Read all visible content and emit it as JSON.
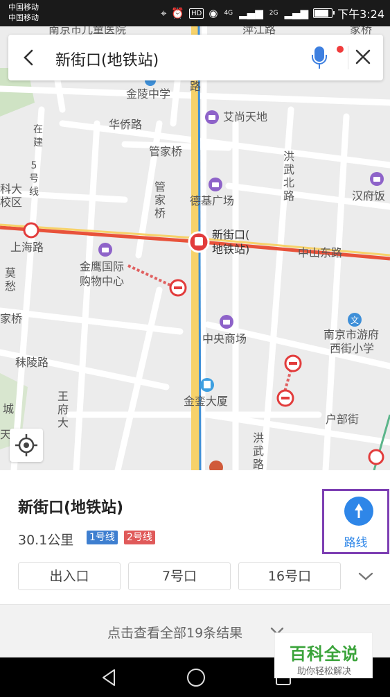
{
  "status_bar": {
    "carrier_1": "中国移动",
    "carrier_2": "中国移动",
    "hd_badge": "HD",
    "net_4g": "4G",
    "net_2g": "2G",
    "time": "下午3:24",
    "battery_level": 0.85,
    "icons": [
      "location-icon",
      "alarm-icon",
      "eye-icon",
      "signal-icon",
      "battery-icon"
    ]
  },
  "search": {
    "query": "新街口(地铁站)",
    "back_icon": "chevron-left-icon",
    "mic_icon": "microphone-icon",
    "close_icon": "close-icon",
    "mic_color": "#3d7fe0",
    "notify_color": "#f03c3c"
  },
  "map": {
    "labels": {
      "children_hospital": "南京市儿童医院",
      "top_mid": "萍江路",
      "top_right": "家桥",
      "jinling_school": "金陵中学",
      "road_fragment": "路",
      "aishang": "艾尚天地",
      "huaqiao_road": "华侨路",
      "guanjiaqiao": "管家桥",
      "zaijian": "在建",
      "line5": "5号线",
      "hongwu_north": "洪武北路",
      "hotel": "汉府饭",
      "left_school_1": "科大",
      "left_school_2": "校区",
      "guanjia_v": "管家桥",
      "deji": "德基广场",
      "xinjiekou_1": "新街口(",
      "xinjiekou_2": "地铁站)",
      "shanghai_road": "上海路",
      "zhongshan_east": "中山东路",
      "jinying_1": "金鹰国际",
      "jinying_2": "购物中心",
      "mochou_v": "莫愁",
      "left_jiaqiao": "家桥",
      "zhongyang": "中央商场",
      "youyou_1": "南京市游府",
      "youyou_2": "西街小学",
      "moling_road": "秣陵路",
      "jinling_building": "金銮大厦",
      "wangfu_v": "王府大",
      "cheng": "城",
      "tian": "天",
      "hubu_street": "户部街",
      "hongwu_road": "洪武路"
    },
    "colors": {
      "background": "#ececec",
      "road": "#ffffff",
      "main_road": "#f7d26a",
      "metro_line_2": "#e8523a",
      "metro_line_1": "#3e8fd8",
      "park": "#cfe3c4",
      "shop_poi": "#8e63c9"
    }
  },
  "locate_icon": "crosshair-icon",
  "panel": {
    "title": "新街口(地铁站)",
    "distance": "30.1公里",
    "lines": [
      {
        "label": "1号线",
        "color": "#3e7fd0"
      },
      {
        "label": "2号线",
        "color": "#e05a5a"
      }
    ],
    "route_label": "路线",
    "route_icon": "route-arrow-icon",
    "exits": [
      "出入口",
      "7号口",
      "16号口"
    ],
    "expand_icon": "chevron-down-icon",
    "results_text": "点击查看全部19条结果",
    "results_icon": "chevron-down-icon"
  },
  "nav_bar": {
    "icons": [
      "back-triangle-icon",
      "home-circle-icon",
      "recents-square-icon"
    ]
  },
  "watermark": {
    "title": "百科全说",
    "subtitle": "助你轻松解决"
  }
}
